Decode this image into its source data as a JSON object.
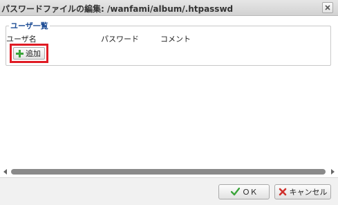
{
  "dialog": {
    "title": "パスワードファイルの編集: /wanfami/album/.htpasswd"
  },
  "users": {
    "legend": "ユーザ一覧",
    "columns": {
      "user": "ユーザ名",
      "password": "パスワード",
      "comment": "コメント"
    },
    "add_label": "追加",
    "rows": []
  },
  "footer": {
    "ok_label": "ＯＫ",
    "cancel_label": "キャンセル"
  },
  "colors": {
    "highlight_border": "#e01b24",
    "add_icon": "#3aa53a",
    "ok_check": "#3aa53a",
    "cancel_x": "#d0312d",
    "legend_text": "#1f4e96"
  },
  "icons": {
    "close": "close-icon",
    "add": "plus-icon",
    "ok": "check-icon",
    "cancel": "x-icon"
  }
}
